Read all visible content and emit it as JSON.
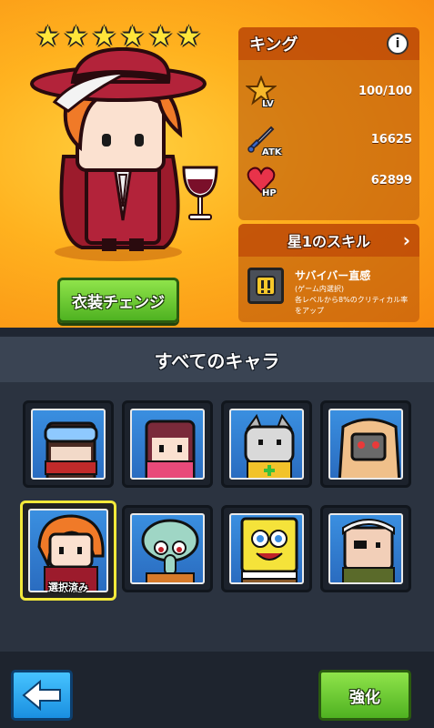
{
  "hero": {
    "stars": [
      "★",
      "★",
      "★",
      "★",
      "★",
      "★"
    ],
    "name": "キング",
    "costume_button": "衣装チェンジ",
    "stats": [
      {
        "label": "LV",
        "value": "100/100",
        "icon": "level-star-icon"
      },
      {
        "label": "ATK",
        "value": "16625",
        "icon": "sword-icon"
      },
      {
        "label": "HP",
        "value": "62899",
        "icon": "heart-icon"
      }
    ],
    "info_icon": "i"
  },
  "skill": {
    "title": "星1のスキル",
    "chevron": "›",
    "name": "サバイバー直感",
    "sub": "(ゲーム内選択)",
    "desc": "各レベルから8%のクリティカル率をアップ"
  },
  "roster": {
    "title": "すべてのキャラ",
    "selected_label": "選択済み",
    "characters": [
      {
        "name": "goggles-masked-hero",
        "color": "#3b8ee0"
      },
      {
        "name": "ninja-girl",
        "color": "#3b8ee0"
      },
      {
        "name": "cat-hero",
        "color": "#3b8ee0"
      },
      {
        "name": "hooded-robot",
        "color": "#3b8ee0"
      },
      {
        "name": "king-hero",
        "color": "#3b8ee0",
        "selected": true
      },
      {
        "name": "squidward",
        "color": "#3b8ee0"
      },
      {
        "name": "spongebob",
        "color": "#3b8ee0"
      },
      {
        "name": "eyepatch-soldier",
        "color": "#3b8ee0"
      }
    ]
  },
  "footer": {
    "back_icon": "left-arrow-icon",
    "upgrade_button": "強化"
  },
  "colors": {
    "accent_green": "#4fb221",
    "accent_blue": "#1a8fe0",
    "background_orange": "#ffb21f",
    "selected_border": "#f3e93a"
  }
}
